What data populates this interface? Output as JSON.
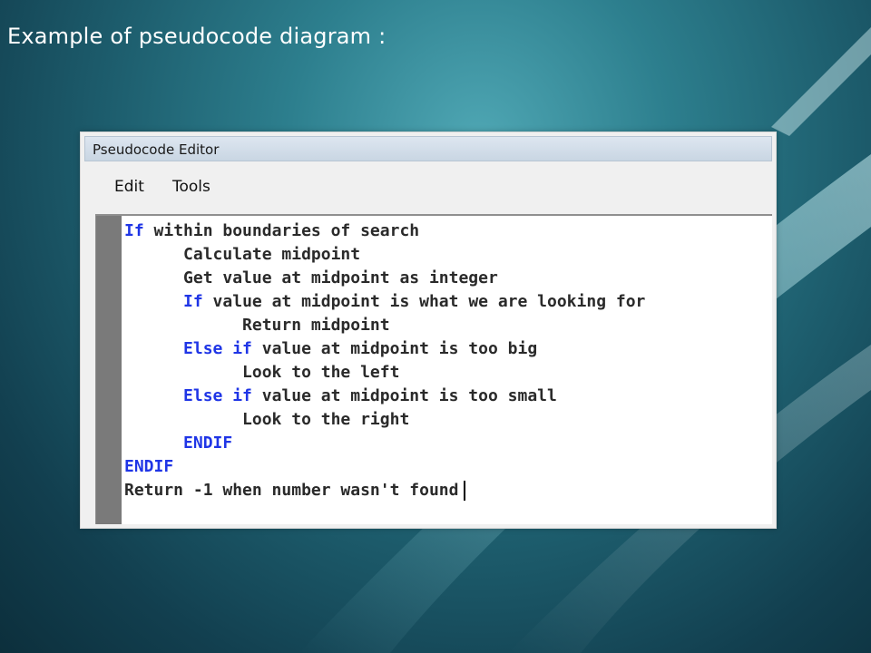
{
  "slide": {
    "title": "Example of pseudocode diagram :"
  },
  "window": {
    "title": "Pseudocode Editor"
  },
  "menu": {
    "items": [
      {
        "label": "Edit"
      },
      {
        "label": "Tools"
      }
    ]
  },
  "colors": {
    "keyword": "#1f35e6",
    "text": "#2a2a2a",
    "gutter": "#7a7a7a"
  },
  "code": {
    "lines": [
      {
        "indent": "",
        "keyword": "If",
        "rest": " within boundaries of search"
      },
      {
        "indent": "      ",
        "keyword": "",
        "rest": "Calculate midpoint"
      },
      {
        "indent": "      ",
        "keyword": "",
        "rest": "Get value at midpoint as integer"
      },
      {
        "indent": "      ",
        "keyword": "If",
        "rest": " value at midpoint is what we are looking for"
      },
      {
        "indent": "            ",
        "keyword": "",
        "rest": "Return midpoint"
      },
      {
        "indent": "      ",
        "keyword": "Else if",
        "rest": " value at midpoint is too big"
      },
      {
        "indent": "            ",
        "keyword": "",
        "rest": "Look to the left"
      },
      {
        "indent": "      ",
        "keyword": "Else if",
        "rest": " value at midpoint is too small"
      },
      {
        "indent": "            ",
        "keyword": "",
        "rest": "Look to the right"
      },
      {
        "indent": "      ",
        "keyword": "ENDIF",
        "rest": ""
      },
      {
        "indent": "",
        "keyword": "ENDIF",
        "rest": ""
      },
      {
        "indent": "",
        "keyword": "",
        "rest": "Return -1 when number wasn't found",
        "caret": true
      }
    ]
  }
}
